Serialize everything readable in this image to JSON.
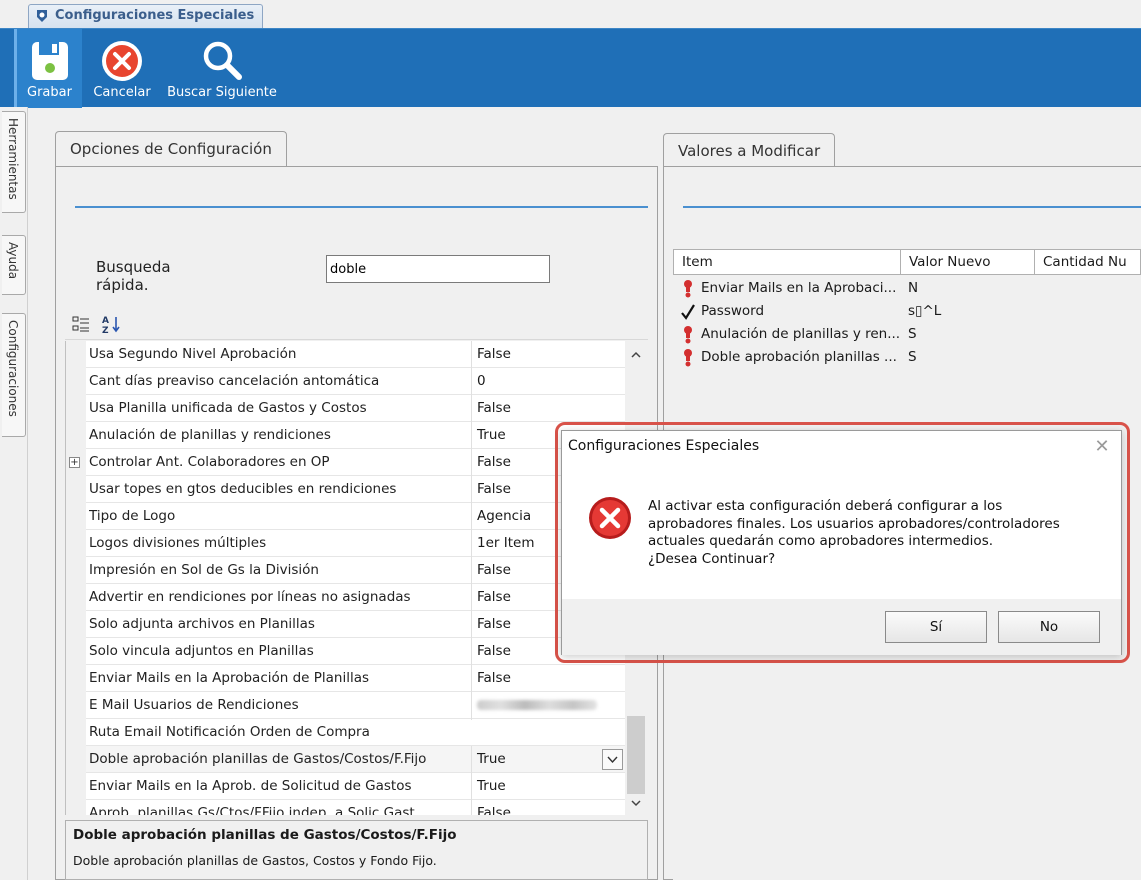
{
  "window": {
    "tab_title": "Configuraciones Especiales"
  },
  "toolbar": {
    "save_label": "Grabar",
    "cancel_label": "Cancelar",
    "find_next_label": "Buscar Siguiente"
  },
  "side_tabs": [
    "Herramientas",
    "Ayuda",
    "Configuraciones"
  ],
  "left_panel": {
    "tab_label": "Opciones de Configuración",
    "search_label": "Busqueda rápida.",
    "search_value": "doble",
    "rows": [
      {
        "name": "Usa Segundo Nivel Aprobación",
        "value": "False"
      },
      {
        "name": "Cant días preaviso cancelación antomática",
        "value": "0"
      },
      {
        "name": "Usa Planilla unificada de Gastos y Costos",
        "value": "False"
      },
      {
        "name": "Anulación de planillas y rendiciones",
        "value": "True"
      },
      {
        "name": "Controlar Ant. Colaboradores en OP",
        "value": "False"
      },
      {
        "name": "Usar topes en gtos deducibles en rendiciones",
        "value": "False"
      },
      {
        "name": "Tipo de Logo",
        "value": "Agencia"
      },
      {
        "name": "Logos divisiones múltiples",
        "value": "1er Item"
      },
      {
        "name": "Impresión en Sol de Gs la División",
        "value": "False"
      },
      {
        "name": "Advertir en rendiciones por líneas no asignadas",
        "value": "False"
      },
      {
        "name": "Solo adjunta archivos en Planillas",
        "value": "False"
      },
      {
        "name": "Solo vincula adjuntos en Planillas",
        "value": "False"
      },
      {
        "name": "Enviar Mails en la Aprobación de Planillas",
        "value": "False"
      },
      {
        "name": "E Mail Usuarios de Rendiciones",
        "value": ""
      },
      {
        "name": "Ruta Email Notificación Orden de Compra",
        "value": ""
      },
      {
        "name": "Doble aprobación planillas de Gastos/Costos/F.Fijo",
        "value": "True"
      },
      {
        "name": "Enviar Mails en la Aprob. de Solicitud de Gastos",
        "value": "True"
      },
      {
        "name": "Aprob. planillas Gs/Ctos/FFijo indep. a Solic Gast.",
        "value": "False"
      }
    ],
    "description_title": "Doble aprobación planillas de Gastos/Costos/F.Fijo",
    "description_text": "Doble aprobación planillas de Gastos, Costos y Fondo Fijo."
  },
  "right_panel": {
    "tab_label": "Valores a Modificar",
    "columns": [
      "Item",
      "Valor Nuevo",
      "Cantidad Nu"
    ],
    "rows": [
      {
        "icon": "exclamation-icon",
        "item": "Enviar Mails en la Aprobaci...",
        "value": "N"
      },
      {
        "icon": "checkmark-icon",
        "item": "Password",
        "value": "s▯^L"
      },
      {
        "icon": "exclamation-icon",
        "item": "Anulación de planillas y ren...",
        "value": "S"
      },
      {
        "icon": "exclamation-icon",
        "item": "Doble aprobación planillas ...",
        "value": "S"
      }
    ]
  },
  "dialog": {
    "title": "Configuraciones Especiales",
    "message_lines": [
      "Al activar esta configuración deberá configurar a los",
      "aprobadores finales. Los usuarios aprobadores/controladores",
      "actuales quedarán como aprobadores intermedios.",
      "¿Desea Continuar?"
    ],
    "yes_label": "Sí",
    "no_label": "No",
    "close_glyph": "✕"
  },
  "colors": {
    "toolbar_bg": "#1f6fb7",
    "accent_line": "#4a90d0",
    "highlight_border": "#d9534a",
    "error_red": "#d9342b"
  }
}
